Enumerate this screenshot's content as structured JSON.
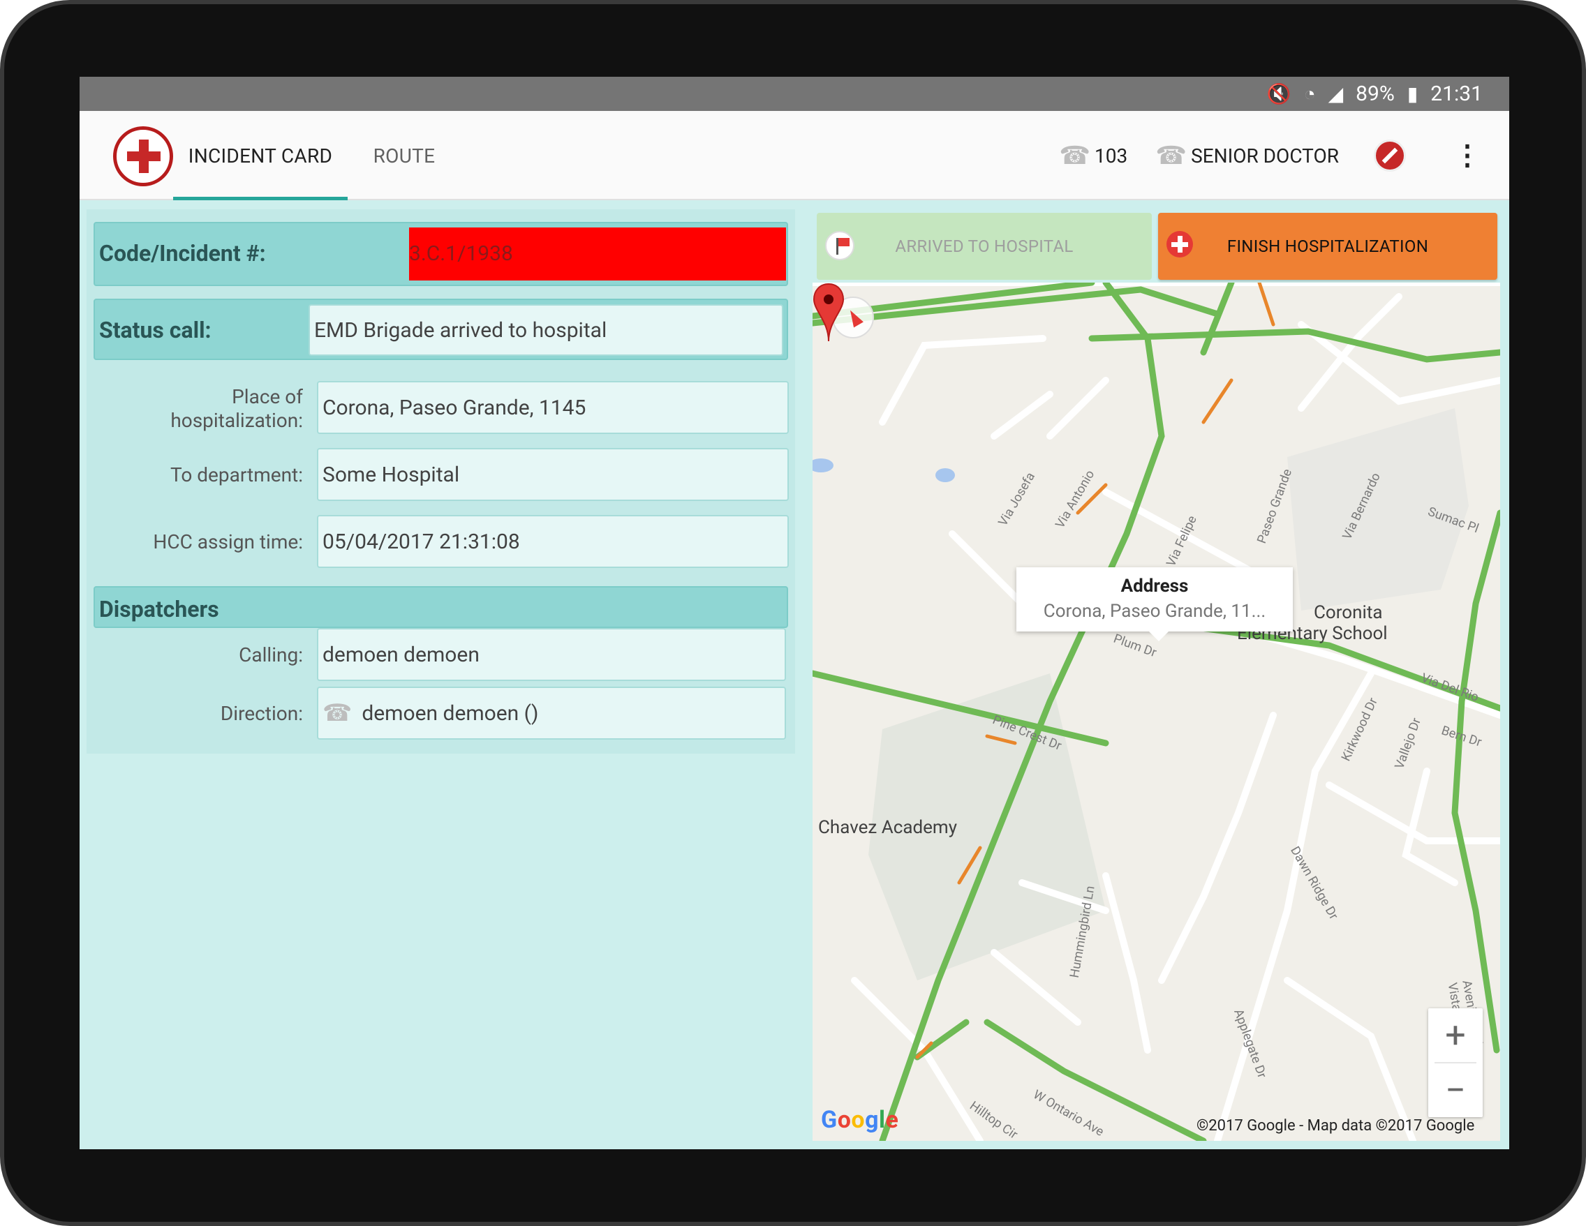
{
  "status_bar": {
    "battery": "89%",
    "time": "21:31",
    "icons": [
      "mute-vibrate-icon",
      "wifi-icon",
      "signal-icon",
      "battery-icon"
    ]
  },
  "appbar": {
    "tabs": [
      {
        "label": "INCIDENT CARD",
        "active": true
      },
      {
        "label": "ROUTE",
        "active": false
      }
    ],
    "phone_number": "103",
    "role": "SENIOR DOCTOR",
    "accent": "#26a69a"
  },
  "form": {
    "code": {
      "label": "Code/Incident #:",
      "value": "3.C.1/1938",
      "highlight": "#ff0000"
    },
    "status": {
      "label": "Status call:",
      "value": "EMD Brigade arrived to hospital"
    },
    "place": {
      "label_line1": "Place of",
      "label_line2": "hospitalization:",
      "value": "Corona,  Paseo Grande, 1145"
    },
    "department": {
      "label": "To department:",
      "value": "Some Hospital"
    },
    "hcc": {
      "label": "HCC assign time:",
      "value": "05/04/2017 21:31:08"
    },
    "dispatchers": {
      "title": "Dispatchers",
      "calling": {
        "label": "Calling:",
        "value": "demoen demoen"
      },
      "direction": {
        "label": "Direction:",
        "value": "demoen demoen ()"
      }
    }
  },
  "actions": {
    "arrived": {
      "label": "ARRIVED TO HOSPITAL",
      "enabled": false
    },
    "finish": {
      "label": "FINISH HOSPITALIZATION",
      "color": "#ef8033"
    }
  },
  "map": {
    "info_window": {
      "title": "Address",
      "body": "Corona,  Paseo Grande, 11..."
    },
    "streets": [
      "Via Josefa",
      "Via Antonio",
      "Via Felipe",
      "Paseo Grande",
      "Via Bernardo",
      "Sumac Pl",
      "Via Del Rio",
      "Bern Dr",
      "Kirkwood Dr",
      "Vallejo Dr",
      "Pine Crest Dr",
      "Dawn Ridge Dr",
      "Hummingbird Ln",
      "Applegate Dr",
      "Avenida Del Vista",
      "W Ontario Ave",
      "Hilltop Cir",
      "Plum Dr"
    ],
    "pois": [
      "Coronita",
      "Elementary School",
      "Chavez Academy"
    ],
    "zoom_in": "+",
    "zoom_out": "−",
    "logo": "Google",
    "copyright": "©2017 Google - Map data ©2017 Google"
  }
}
